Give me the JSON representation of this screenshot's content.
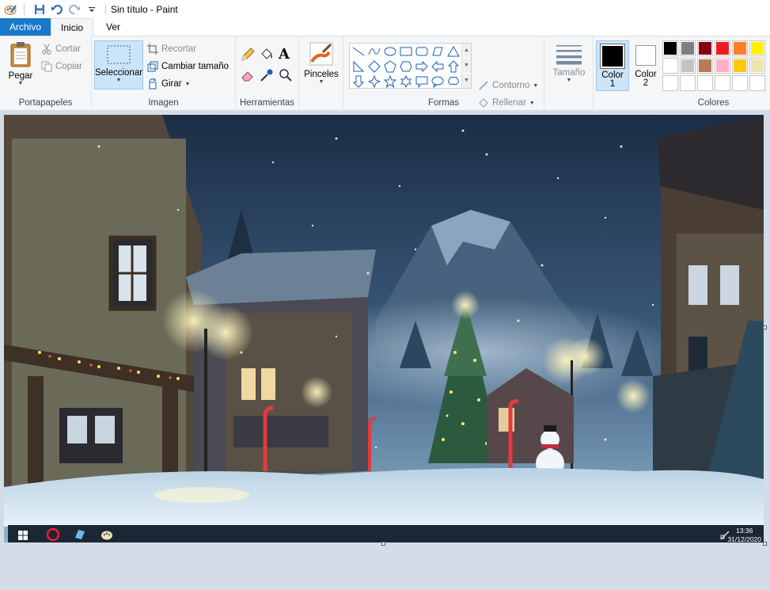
{
  "window": {
    "title": "Sin título - Paint"
  },
  "tabs": [
    {
      "label": "Archivo"
    },
    {
      "label": "Inicio"
    },
    {
      "label": "Ver"
    }
  ],
  "clipboard": {
    "paste": "Pegar",
    "cut": "Cortar",
    "copy": "Copiar",
    "group": "Portapapeles"
  },
  "image": {
    "select": "Seleccionar",
    "crop": "Recortar",
    "resize": "Cambiar tamaño",
    "rotate": "Girar",
    "group": "Imagen"
  },
  "tools": {
    "group": "Herramientas"
  },
  "brushes": {
    "label": "Pinceles"
  },
  "shapes": {
    "outline": "Contorno",
    "fill": "Rellenar",
    "group": "Formas"
  },
  "size": {
    "label": "Tamaño"
  },
  "colors": {
    "color1_label": "Color",
    "color1_num": "1",
    "color2_label": "Color",
    "color2_num": "2",
    "color1_value": "#000000",
    "color2_value": "#ffffff",
    "group": "Colores",
    "palette": [
      "#000000",
      "#7f7f7f",
      "#880015",
      "#ed1c24",
      "#ff7f27",
      "#fff200",
      "#ffffff",
      "#c3c3c3",
      "#b97a57",
      "#ffaec9",
      "#ffc90e",
      "#efe4b0"
    ]
  },
  "taskbar": {
    "time": "13:36",
    "date": "31/12/2020"
  }
}
